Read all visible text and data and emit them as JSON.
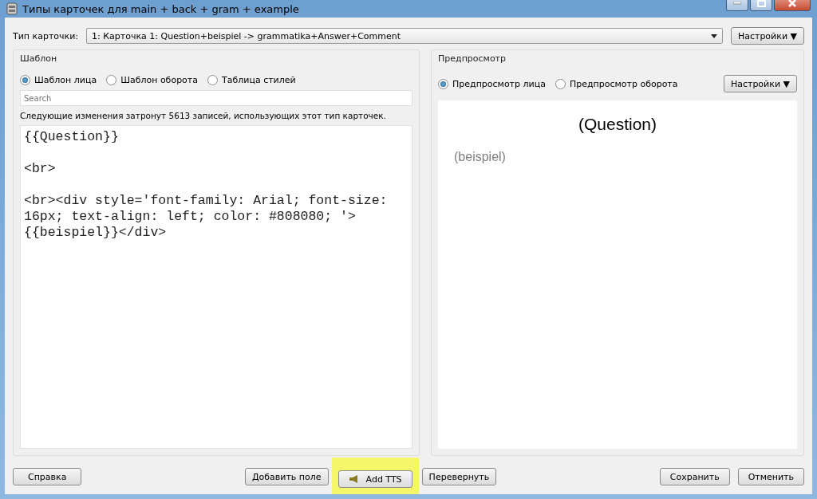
{
  "window": {
    "title": "Типы карточек для main + back + gram + example"
  },
  "card_type": {
    "label": "Тип карточки:",
    "value": "1: Карточка 1: Question+beispiel -> grammatika+Answer+Comment",
    "options_button": "Настройки ▼"
  },
  "template": {
    "title": "Шаблон",
    "radios": [
      {
        "label": "Шаблон лица",
        "selected": true
      },
      {
        "label": "Шаблон оборота",
        "selected": false
      },
      {
        "label": "Таблица стилей",
        "selected": false
      }
    ],
    "search": {
      "placeholder": "Search"
    },
    "notice": "Следующие изменения затронут 5613 записей, использующих этот тип карточек.",
    "code": "{{Question}}\n\n<br>\n\n<br><div style='font-family: Arial; font-size: 16px; text-align: left; color: #808080; '>{{beispiel}}</div>"
  },
  "preview": {
    "title": "Предпросмотр",
    "radios": [
      {
        "label": "Предпросмотр лица",
        "selected": true
      },
      {
        "label": "Предпросмотр оборота",
        "selected": false
      }
    ],
    "options_button": "Настройки ▼",
    "question": "(Question)",
    "example": "(beispiel)"
  },
  "buttons": {
    "help": "Справка",
    "add_field": "Добавить поле",
    "add_tts": "Add TTS",
    "flip": "Перевернуть",
    "save": "Сохранить",
    "cancel": "Отменить"
  }
}
